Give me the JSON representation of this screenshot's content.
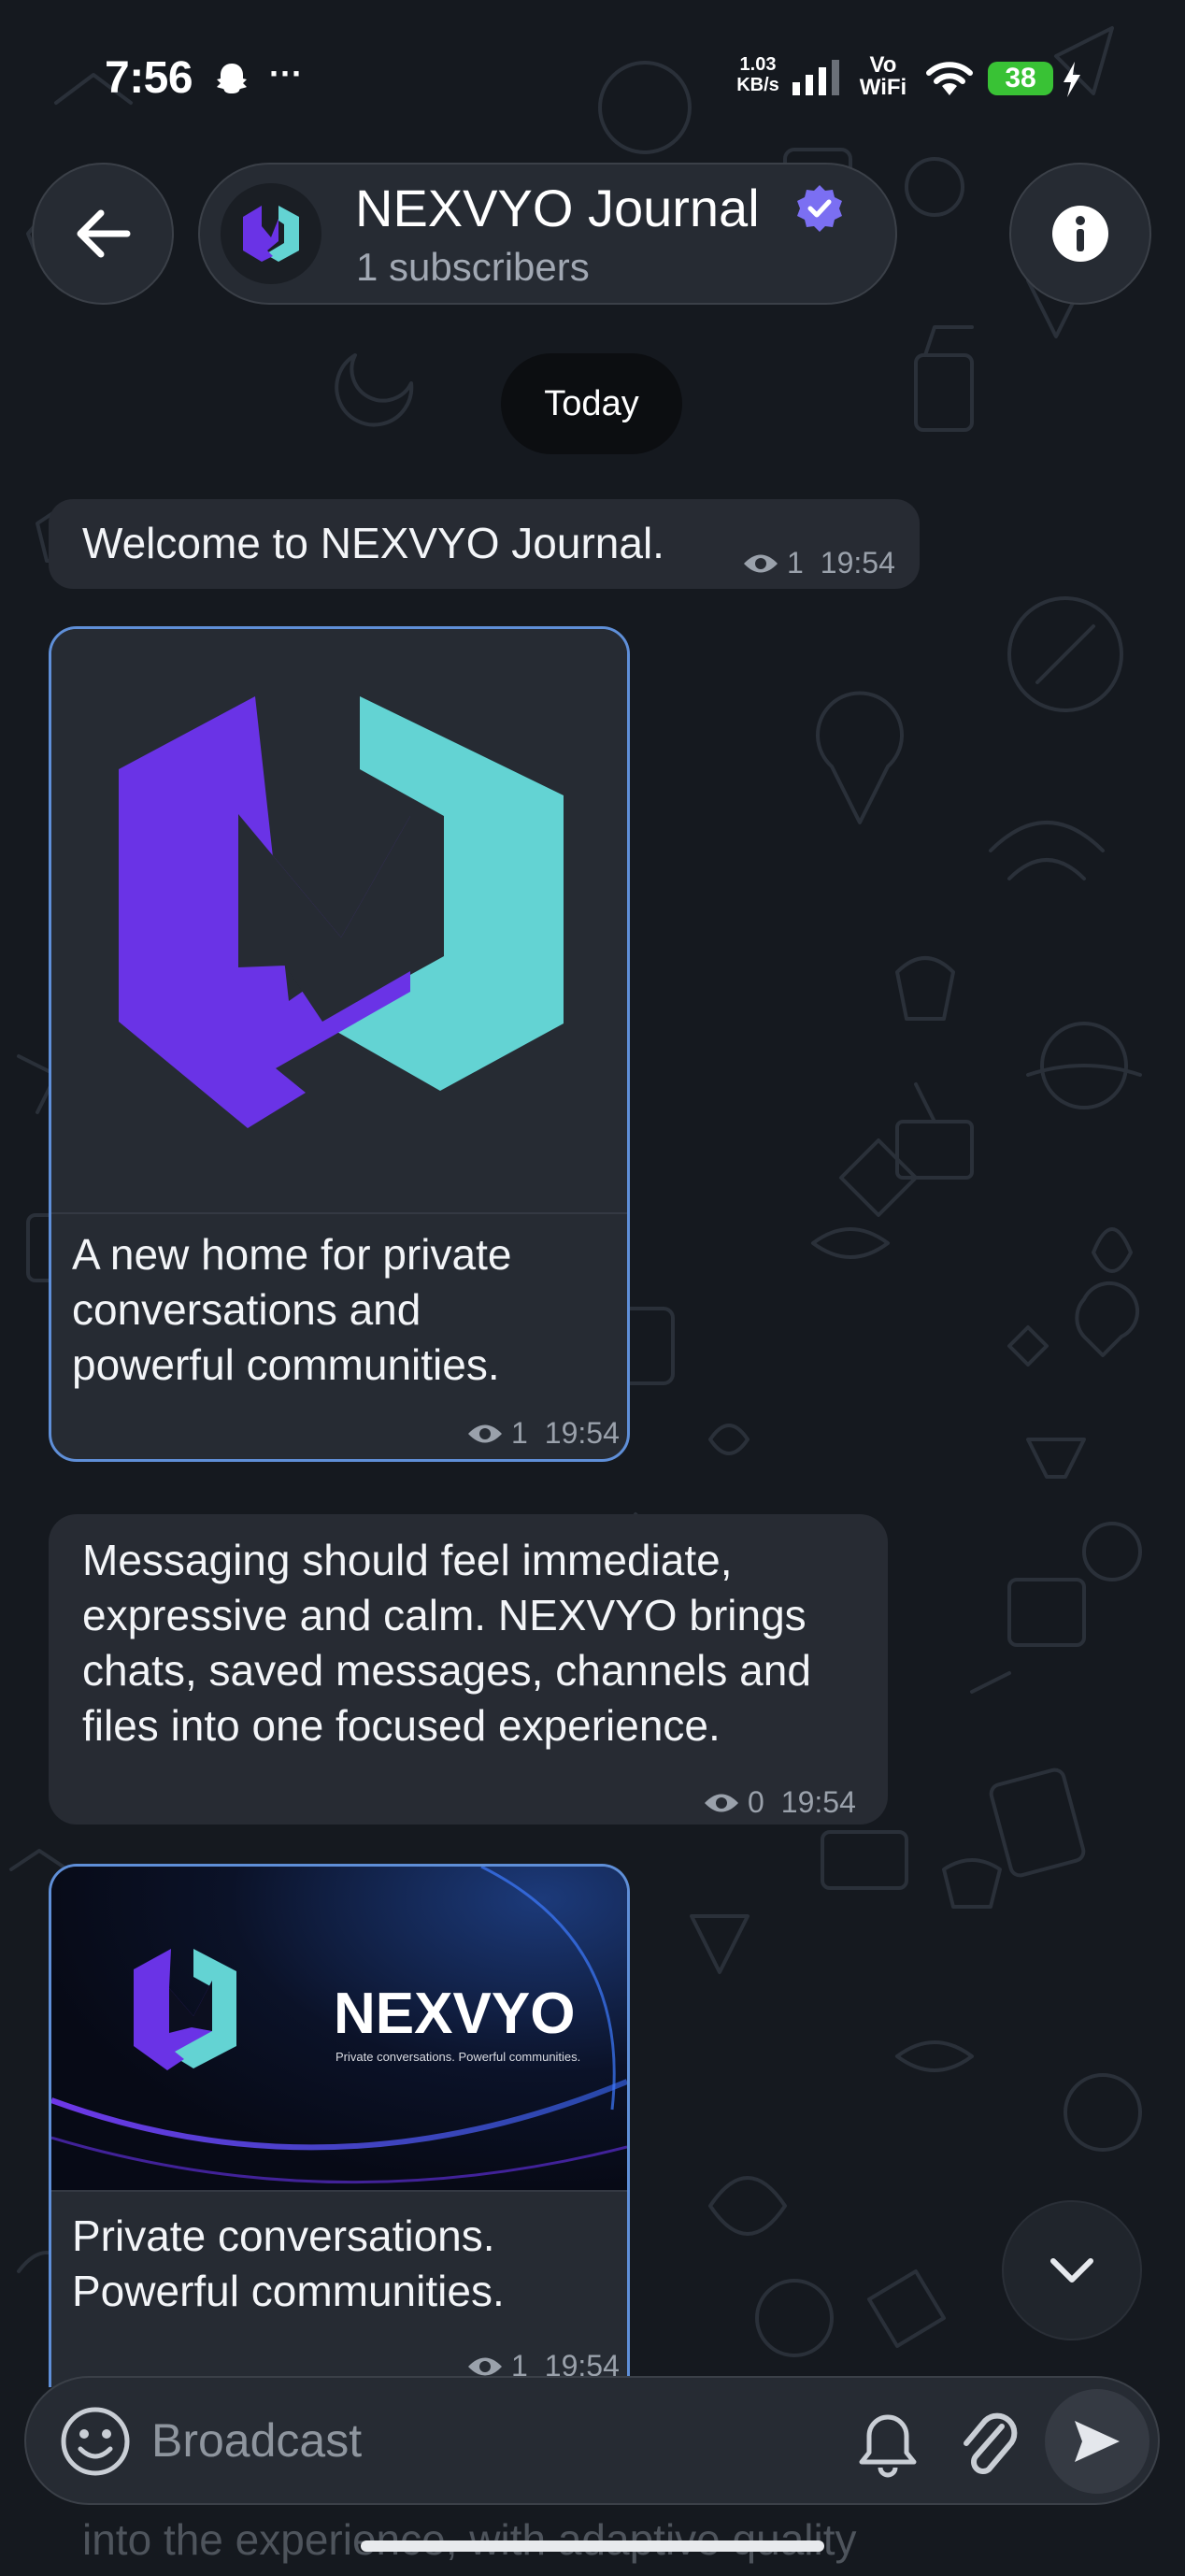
{
  "status_bar": {
    "time": "7:56",
    "more": "···",
    "net_speed_value": "1.03",
    "net_speed_unit": "KB/s",
    "vo": "Vo",
    "wifi": "WiFi",
    "battery": "38"
  },
  "header": {
    "title": "NEXVYO Journal",
    "subtitle": "1 subscribers"
  },
  "date_separator": "Today",
  "messages": [
    {
      "text": "Welcome to NEXVYO Journal.",
      "views": "1",
      "time": "19:54"
    },
    {
      "caption_lines": [
        "A new home for private",
        "conversations and",
        "powerful communities."
      ],
      "views": "1",
      "time": "19:54"
    },
    {
      "text_lines": [
        "Messaging should feel immediate,",
        "expressive and calm. NEXVYO brings",
        "chats, saved messages, channels and",
        "files into one focused experience."
      ],
      "views": "0",
      "time": "19:54"
    },
    {
      "banner_brand": "NEXVYO",
      "banner_tagline": "Private conversations. Powerful communities.",
      "caption_lines": [
        "Private conversations.",
        "Powerful communities."
      ],
      "views": "1",
      "time": "19:54"
    }
  ],
  "composer": {
    "placeholder": "Broadcast"
  },
  "partial_next_text": "into the experience, with adaptive quality",
  "colors": {
    "accent_blue": "#5f8fd8",
    "logo_purple": "#6a33e6",
    "logo_teal": "#63d3d3",
    "verified": "#7b6ff2",
    "battery_green": "#39c235"
  }
}
